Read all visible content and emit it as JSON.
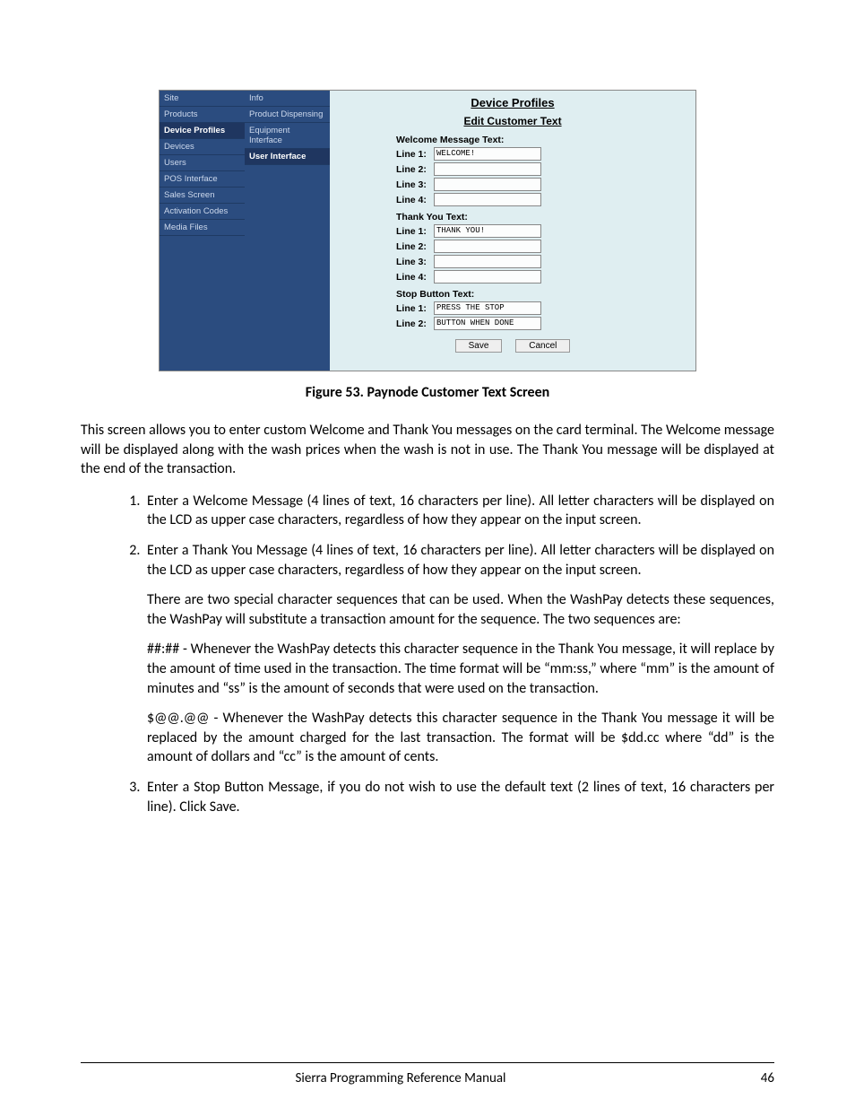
{
  "nav1": {
    "items": [
      {
        "label": "Site"
      },
      {
        "label": "Products"
      },
      {
        "label": "Device Profiles",
        "selected": true
      },
      {
        "label": "Devices"
      },
      {
        "label": "Users"
      },
      {
        "label": "POS Interface"
      },
      {
        "label": "Sales Screen"
      },
      {
        "label": "Activation Codes"
      },
      {
        "label": "Media Files"
      }
    ]
  },
  "nav2": {
    "items": [
      {
        "label": "Info"
      },
      {
        "label": "Product Dispensing"
      },
      {
        "label": "Equipment Interface"
      },
      {
        "label": "User Interface",
        "selected": true
      }
    ]
  },
  "panel": {
    "title": "Device Profiles",
    "subtitle": "Edit Customer Text",
    "welcome_label": "Welcome Message Text:",
    "thank_label": "Thank You Text:",
    "stop_label": "Stop Button Text:",
    "line_labels": {
      "l1": "Line 1:",
      "l2": "Line 2:",
      "l3": "Line 3:",
      "l4": "Line 4:"
    },
    "welcome": {
      "l1": "WELCOME!",
      "l2": "",
      "l3": "",
      "l4": ""
    },
    "thank": {
      "l1": "THANK YOU!",
      "l2": "",
      "l3": "",
      "l4": ""
    },
    "stop": {
      "l1": "PRESS THE STOP",
      "l2": "BUTTON WHEN DONE"
    },
    "save": "Save",
    "cancel": "Cancel"
  },
  "caption": "Figure 53. Paynode Customer Text Screen",
  "intro": "This screen allows you to enter custom Welcome and Thank You messages on the card terminal. The Welcome message will be displayed along with the wash prices when the wash is not in use. The Thank You message will be displayed at the end of the transaction.",
  "steps": {
    "s1": "Enter a Welcome Message (4 lines of text, 16 characters per line). All letter characters will be displayed on the LCD as upper case characters, regardless of how they appear on the input screen.",
    "s2": "Enter a Thank You Message (4 lines of text, 16 characters per line). All letter characters will be displayed on the LCD as upper case characters, regardless of how they appear on the input screen.",
    "s2p1": "There are two special character sequences that can be used. When the WashPay detects these sequences, the WashPay will substitute a transaction amount for the sequence.  The two sequences are:",
    "s2p2": "##:## - Whenever the WashPay detects this character sequence in the Thank You message, it will replace by the amount of time used in the transaction. The time format will be “mm:ss,” where “mm” is the amount of minutes and “ss” is the amount of seconds that were used on the transaction.",
    "s2p3": "$@@.@@ - Whenever the WashPay detects this character sequence in the Thank You message it will be replaced by the amount charged for the last transaction. The format will be $dd.cc where “dd” is the amount of dollars and “cc” is the amount of cents.",
    "s3": "Enter a Stop Button Message, if you do not wish to use the default text (2 lines of text, 16 characters per line). Click Save."
  },
  "footer": {
    "title": "Sierra Programming Reference Manual",
    "page": "46"
  }
}
